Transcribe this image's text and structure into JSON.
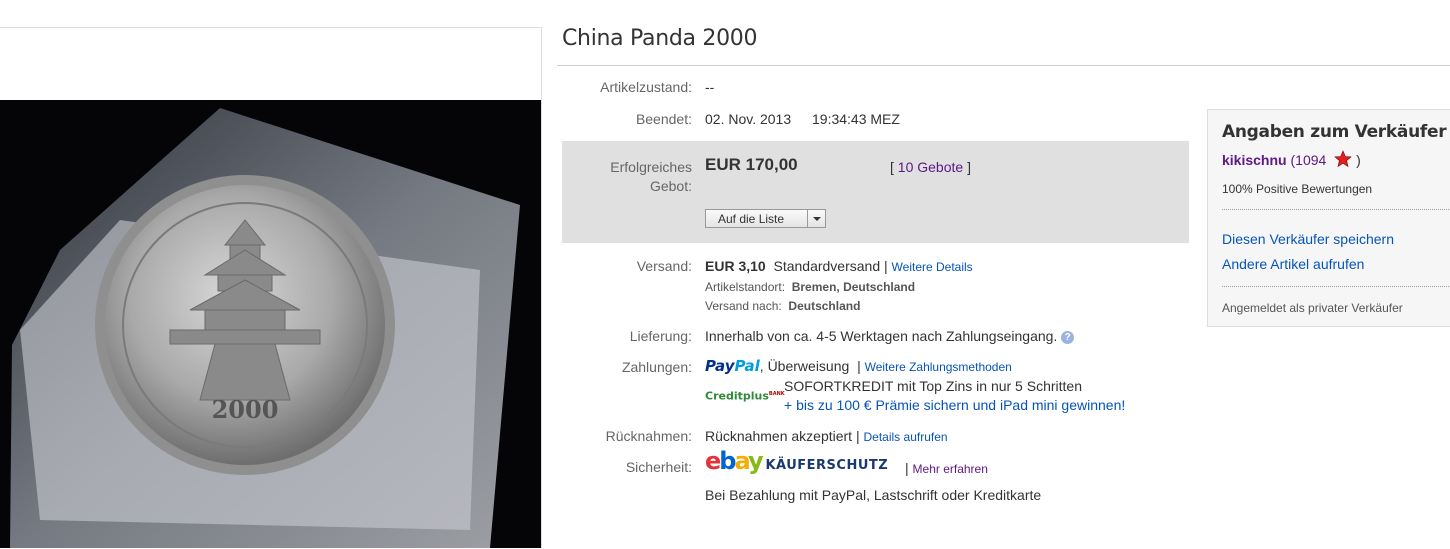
{
  "listing": {
    "title": "China Panda 2000"
  },
  "image": {
    "coin_year": "2000"
  },
  "details": {
    "condition": {
      "label": "Artikelzustand:",
      "value": "--"
    },
    "ended": {
      "label": "Beendet:",
      "date": "02. Nov. 2013",
      "time": "19:34:43 MEZ"
    },
    "bid": {
      "label_line1": "Erfolgreiches",
      "label_line2": "Gebot:",
      "price": "EUR 170,00",
      "bids_open": "[",
      "bids_count": "10 Gebote",
      "bids_close": "]",
      "watch_button": "Auf die Liste"
    },
    "shipping": {
      "label": "Versand:",
      "price": "EUR 3,10",
      "method": "Standardversand |",
      "details_link": "Weitere Details",
      "location_label": "Artikelstandort:",
      "location_value": "Bremen, Deutschland",
      "ships_to_label": "Versand nach:",
      "ships_to_value": "Deutschland"
    },
    "delivery": {
      "label": "Lieferung:",
      "text": "Innerhalb von ca. 4-5 Werktagen nach Zahlungseingang.",
      "help": "?"
    },
    "payments": {
      "label": "Zahlungen:",
      "paypal_a": "Pay",
      "paypal_b": "Pal",
      "methods": ", Überweisung",
      "sep": "|",
      "more_link": "Weitere Zahlungsmethoden",
      "creditplus": "Creditplus",
      "creditplus_tag": "BANK",
      "credit_text": "SOFORTKREDIT mit Top Zins in nur 5 Schritten",
      "credit_link": "+ bis zu 100 € Prämie sichern und iPad mini gewinnen!"
    },
    "returns": {
      "label": "Rücknahmen:",
      "text": "Rücknahmen akzeptiert |",
      "link": "Details aufrufen"
    },
    "security": {
      "label": "Sicherheit:",
      "ebay_e": "e",
      "ebay_b": "b",
      "ebay_a": "a",
      "ebay_y": "y",
      "protection": "KÄUFERSCHUTZ",
      "sep": "|",
      "more_link": "Mehr erfahren",
      "text": "Bei Bezahlung mit PayPal, Lastschrift oder Kreditkarte"
    }
  },
  "seller": {
    "heading": "Angaben zum Verkäufer",
    "name": "kikischnu",
    "feedback_open": "(",
    "feedback_score": "1094",
    "feedback_close": ")",
    "positive": "100% Positive Bewertungen",
    "save_link": "Diesen Verkäufer speichern",
    "items_link": "Andere Artikel aufrufen",
    "registered": "Angemeldet als privater Verkäufer"
  },
  "colors": {
    "link": "#0654ba",
    "purple": "#5d1786",
    "ebay_e": "#e53238",
    "ebay_b": "#0064d2",
    "ebay_a": "#f5af02",
    "ebay_y": "#86b817"
  },
  "icons": [
    "star-rating-icon",
    "help-icon",
    "dropdown-arrow-icon"
  ]
}
